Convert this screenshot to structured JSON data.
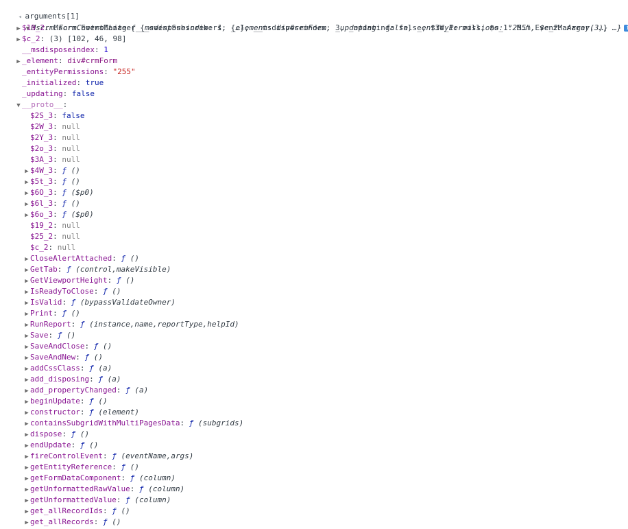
{
  "header": {
    "prompt_caret": "◂",
    "expression": "arguments[1]"
  },
  "root": {
    "class_name": "Mscrm.FormControlLite",
    "preview": "{__msdisposeindex: 1, _element: div#crmForm, _updating: false, _entityPermissions: \"255\", $c_2: Array(3), …}",
    "info_icon": "info-icon"
  },
  "props": [
    {
      "key": "$19_2",
      "sep": ": ",
      "value": "Mscrm.EventManager {_eventSubscribers: {…}, __msdisposeindex: 3, _updating: false, $3W_1: null, $o_1: M…m.EventManager, …}",
      "kind": "obj",
      "expandable": true
    },
    {
      "key": "$c_2",
      "sep": ": ",
      "value": "(3) [102, 46, 98]",
      "kind": "obj",
      "expandable": true
    },
    {
      "key": "__msdisposeindex",
      "sep": ": ",
      "value": "1",
      "kind": "num",
      "expandable": false
    },
    {
      "key": "_element",
      "sep": ": ",
      "value": "div#crmForm",
      "kind": "elt",
      "expandable": true
    },
    {
      "key": "_entityPermissions",
      "sep": ": ",
      "value": "\"255\"",
      "kind": "str",
      "expandable": false
    },
    {
      "key": "_initialized",
      "sep": ": ",
      "value": "true",
      "kind": "bool",
      "expandable": false
    },
    {
      "key": "_updating",
      "sep": ": ",
      "value": "false",
      "kind": "bool",
      "expandable": false
    },
    {
      "key": "__proto__",
      "sep": ":",
      "value": "",
      "kind": "plain",
      "expandable": true,
      "expanded": true,
      "dim": true
    }
  ],
  "proto": [
    {
      "key": "$2S_3",
      "value": "false",
      "kind": "bool",
      "expandable": false
    },
    {
      "key": "$2W_3",
      "value": "null",
      "kind": "null",
      "expandable": false
    },
    {
      "key": "$2Y_3",
      "value": "null",
      "kind": "null",
      "expandable": false
    },
    {
      "key": "$2o_3",
      "value": "null",
      "kind": "null",
      "expandable": false
    },
    {
      "key": "$3A_3",
      "value": "null",
      "kind": "null",
      "expandable": false
    },
    {
      "key": "$4W_3",
      "fsym": "ƒ",
      "value": "()",
      "kind": "fn",
      "expandable": true
    },
    {
      "key": "$5t_3",
      "fsym": "ƒ",
      "value": "()",
      "kind": "fn",
      "expandable": true
    },
    {
      "key": "$6O_3",
      "fsym": "ƒ",
      "value": "($p0)",
      "kind": "fn",
      "expandable": true
    },
    {
      "key": "$6l_3",
      "fsym": "ƒ",
      "value": "()",
      "kind": "fn",
      "expandable": true
    },
    {
      "key": "$6o_3",
      "fsym": "ƒ",
      "value": "($p0)",
      "kind": "fn",
      "expandable": true
    },
    {
      "key": "$19_2",
      "value": "null",
      "kind": "null",
      "expandable": false
    },
    {
      "key": "$25_2",
      "value": "null",
      "kind": "null",
      "expandable": false
    },
    {
      "key": "$c_2",
      "value": "null",
      "kind": "null",
      "expandable": false
    },
    {
      "key": "CloseAlertAttached",
      "fsym": "ƒ",
      "value": "()",
      "kind": "fn",
      "expandable": true
    },
    {
      "key": "GetTab",
      "fsym": "ƒ",
      "value": "(control,makeVisible)",
      "kind": "fn",
      "expandable": true
    },
    {
      "key": "GetViewportHeight",
      "fsym": "ƒ",
      "value": "()",
      "kind": "fn",
      "expandable": true
    },
    {
      "key": "IsReadyToClose",
      "fsym": "ƒ",
      "value": "()",
      "kind": "fn",
      "expandable": true
    },
    {
      "key": "IsValid",
      "fsym": "ƒ",
      "value": "(bypassValidateOwner)",
      "kind": "fn",
      "expandable": true
    },
    {
      "key": "Print",
      "fsym": "ƒ",
      "value": "()",
      "kind": "fn",
      "expandable": true
    },
    {
      "key": "RunReport",
      "fsym": "ƒ",
      "value": "(instance,name,reportType,helpId)",
      "kind": "fn",
      "expandable": true
    },
    {
      "key": "Save",
      "fsym": "ƒ",
      "value": "()",
      "kind": "fn",
      "expandable": true
    },
    {
      "key": "SaveAndClose",
      "fsym": "ƒ",
      "value": "()",
      "kind": "fn",
      "expandable": true
    },
    {
      "key": "SaveAndNew",
      "fsym": "ƒ",
      "value": "()",
      "kind": "fn",
      "expandable": true
    },
    {
      "key": "addCssClass",
      "fsym": "ƒ",
      "value": "(a)",
      "kind": "fn",
      "expandable": true
    },
    {
      "key": "add_disposing",
      "fsym": "ƒ",
      "value": "(a)",
      "kind": "fn",
      "expandable": true
    },
    {
      "key": "add_propertyChanged",
      "fsym": "ƒ",
      "value": "(a)",
      "kind": "fn",
      "expandable": true
    },
    {
      "key": "beginUpdate",
      "fsym": "ƒ",
      "value": "()",
      "kind": "fn",
      "expandable": true
    },
    {
      "key": "constructor",
      "fsym": "ƒ",
      "value": "(element)",
      "kind": "fn",
      "expandable": true
    },
    {
      "key": "containsSubgridWithMultiPagesData",
      "fsym": "ƒ",
      "value": "(subgrids)",
      "kind": "fn",
      "expandable": true
    },
    {
      "key": "dispose",
      "fsym": "ƒ",
      "value": "()",
      "kind": "fn",
      "expandable": true
    },
    {
      "key": "endUpdate",
      "fsym": "ƒ",
      "value": "()",
      "kind": "fn",
      "expandable": true
    },
    {
      "key": "fireControlEvent",
      "fsym": "ƒ",
      "value": "(eventName,args)",
      "kind": "fn",
      "expandable": true
    },
    {
      "key": "getEntityReference",
      "fsym": "ƒ",
      "value": "()",
      "kind": "fn",
      "expandable": true
    },
    {
      "key": "getFormDataComponent",
      "fsym": "ƒ",
      "value": "(column)",
      "kind": "fn",
      "expandable": true
    },
    {
      "key": "getUnformattedRawValue",
      "fsym": "ƒ",
      "value": "(column)",
      "kind": "fn",
      "expandable": true
    },
    {
      "key": "getUnformattedValue",
      "fsym": "ƒ",
      "value": "(column)",
      "kind": "fn",
      "expandable": true
    },
    {
      "key": "get_allRecordIds",
      "fsym": "ƒ",
      "value": "()",
      "kind": "fn",
      "expandable": true
    },
    {
      "key": "get_allRecords",
      "fsym": "ƒ",
      "value": "()",
      "kind": "fn",
      "expandable": true
    }
  ],
  "glyphs": {
    "collapsed": "▶",
    "expanded": "▼",
    "info": "i"
  },
  "colors": {
    "key": "#881391",
    "string": "#c41a16",
    "number": "#1c00cf",
    "boolean": "#0d22aa",
    "null": "#808080"
  }
}
